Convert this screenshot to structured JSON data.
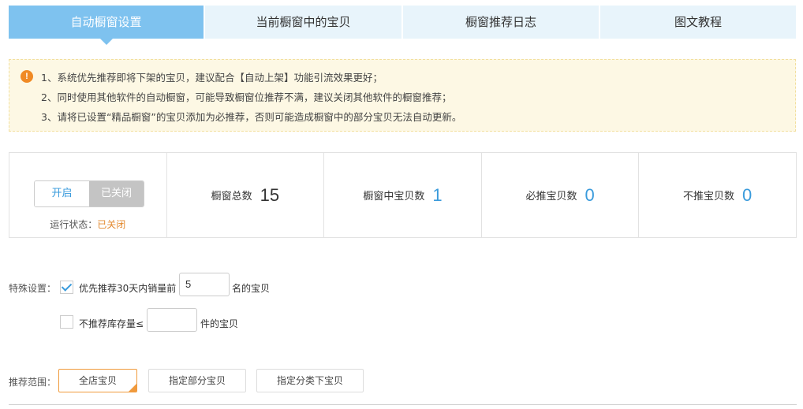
{
  "tabs": [
    {
      "label": "自动橱窗设置",
      "active": true
    },
    {
      "label": "当前橱窗中的宝贝",
      "active": false
    },
    {
      "label": "橱窗推荐日志",
      "active": false
    },
    {
      "label": "图文教程",
      "active": false
    }
  ],
  "notice": {
    "icon": "!",
    "lines": [
      "1、系统优先推荐即将下架的宝贝，建议配合【自动上架】功能引流效果更好；",
      "2、同时使用其他软件的自动橱窗，可能导致橱窗位推荐不满，建议关闭其他软件的橱窗推荐；",
      "3、请将已设置“精品橱窗”的宝贝添加为必推荐，否则可能造成橱窗中的部分宝贝无法自动更新。"
    ]
  },
  "toggle": {
    "on_label": "开启",
    "off_label": "已关闭",
    "status_label": "运行状态：",
    "status_value": "已关闭"
  },
  "stats": [
    {
      "label": "橱窗总数",
      "value": "15"
    },
    {
      "label": "橱窗中宝贝数",
      "value": "1"
    },
    {
      "label": "必推宝贝数",
      "value": "0"
    },
    {
      "label": "不推宝贝数",
      "value": "0"
    }
  ],
  "special": {
    "label": "特殊设置：",
    "opt1_prefix": "优先推荐30天内销量前",
    "opt1_value": "5",
    "opt1_suffix": "名的宝贝",
    "opt1_checked": true,
    "opt2_prefix": "不推荐库存量≤",
    "opt2_value": "",
    "opt2_suffix": "件的宝贝",
    "opt2_checked": false
  },
  "range": {
    "label": "推荐范围：",
    "options": [
      "全店宝贝",
      "指定部分宝贝",
      "指定分类下宝贝"
    ],
    "selected": "全店宝贝"
  },
  "colors": {
    "accent": "#7ec2ef",
    "blue": "#3a9bdc",
    "orange": "#f09a3c",
    "notice_bg": "#fdf8e4"
  }
}
